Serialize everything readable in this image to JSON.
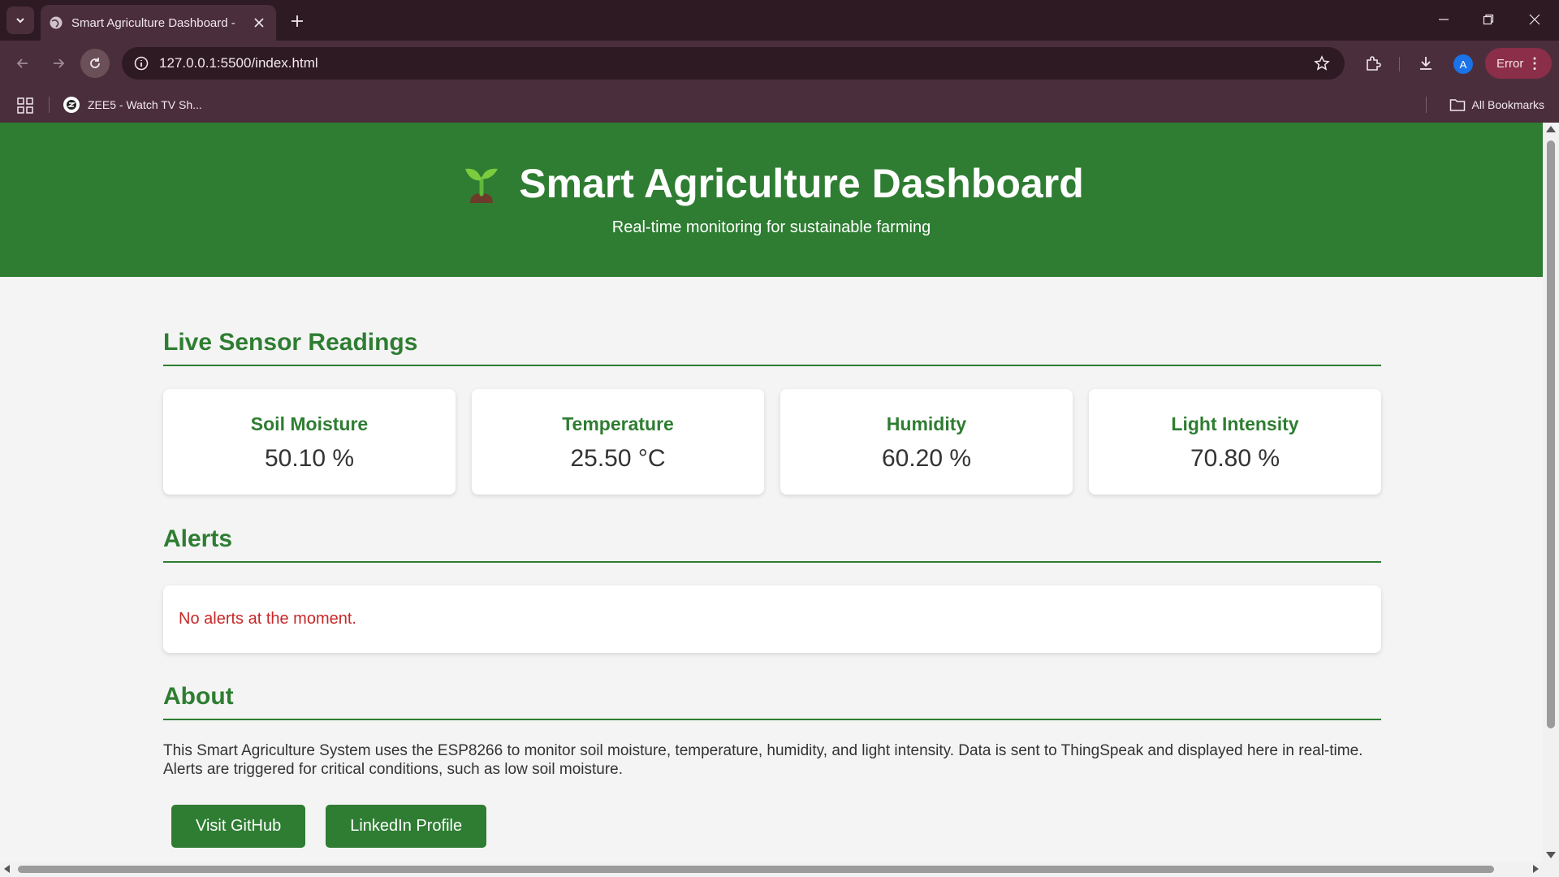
{
  "browser": {
    "tab_title": "Smart Agriculture Dashboard - ",
    "url": "127.0.0.1:5500/index.html",
    "profile_initial": "A",
    "error_label": "Error",
    "bookmarks": [
      {
        "label": "ZEE5 - Watch TV Sh..."
      }
    ],
    "all_bookmarks_label": "All Bookmarks"
  },
  "header": {
    "title": "Smart Agriculture Dashboard",
    "subtitle": "Real-time monitoring for sustainable farming",
    "icon": "sprout-icon"
  },
  "sensors": {
    "section_title": "Live Sensor Readings",
    "cards": [
      {
        "label": "Soil Moisture",
        "value": "50.10 %"
      },
      {
        "label": "Temperature",
        "value": "25.50 °C"
      },
      {
        "label": "Humidity",
        "value": "60.20 %"
      },
      {
        "label": "Light Intensity",
        "value": "70.80 %"
      }
    ]
  },
  "alerts": {
    "section_title": "Alerts",
    "message": "No alerts at the moment."
  },
  "about": {
    "section_title": "About",
    "text": "This Smart Agriculture System uses the ESP8266 to monitor soil moisture, temperature, humidity, and light intensity. Data is sent to ThingSpeak and displayed here in real-time. Alerts are triggered for critical conditions, such as low soil moisture.",
    "buttons": [
      {
        "label": "Visit GitHub"
      },
      {
        "label": "LinkedIn Profile"
      }
    ]
  },
  "colors": {
    "primary_green": "#2e7d32",
    "alert_red": "#c62828",
    "page_bg": "#f4f4f4",
    "chrome_dark": "#2e1a23",
    "chrome_mid": "#4b2e3b"
  }
}
